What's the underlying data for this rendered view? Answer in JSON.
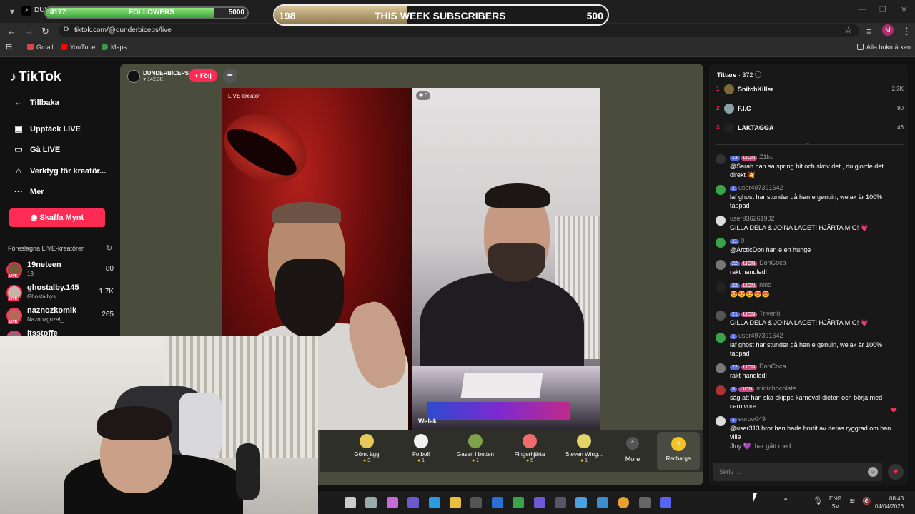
{
  "browser": {
    "tab_title": "DUNDERBICEPS",
    "url": "tiktok.com/@dunderbiceps/live",
    "profile_initial": "M",
    "bookmarks": [
      "Gmail",
      "YouTube",
      "Maps"
    ],
    "all_bookmarks": "Alla bokmärken"
  },
  "overlays": {
    "followers": {
      "current": "4177",
      "label": "FOLLOWERS",
      "goal": "5000",
      "progress": 0.835
    },
    "subscribers": {
      "current": "198",
      "label": "THIS WEEK SUBSCRIBERS",
      "goal": "500",
      "progress": 0.396
    }
  },
  "sidebar": {
    "logo": "TikTok",
    "back": "Tillbaka",
    "items": [
      {
        "label": "Upptäck LIVE",
        "icon": "calendar-live-icon"
      },
      {
        "label": "Gå LIVE",
        "icon": "camera-icon"
      },
      {
        "label": "Verktyg för kreatör...",
        "icon": "creator-tools-icon"
      },
      {
        "label": "Mer",
        "icon": "more-dots-icon"
      }
    ],
    "coins_button": "Skaffa Mynt",
    "suggested_title": "Föreslagna LIVE-kreatörer",
    "creators": [
      {
        "name": "19neteen",
        "sub": "19",
        "count": "80"
      },
      {
        "name": "ghostalby.145",
        "sub": "Ghostalbys",
        "count": "1.7K"
      },
      {
        "name": "naznozkomik",
        "sub": "Naznozguzel_",
        "count": "265"
      },
      {
        "name": "itsstoffe",
        "sub": "",
        "count": ""
      }
    ]
  },
  "live": {
    "host_name": "DUNDERBICEPS",
    "host_likes": "♥ 142.3K",
    "follow_label": "+ Följ",
    "left_label": "LIVE-kreatör",
    "right_badge": "0",
    "guest_name": "Welak",
    "gifts": [
      {
        "name": "Gömt ägg",
        "cost": "3",
        "color": "#e7c95b"
      },
      {
        "name": "Fotboll",
        "cost": "1",
        "color": "#f2f2f2"
      },
      {
        "name": "Gasen i botten",
        "cost": "1",
        "color": "#7ca34a"
      },
      {
        "name": "Fingerhjärta",
        "cost": "5",
        "color": "#f06b6b"
      },
      {
        "name": "Steven Wing...",
        "cost": "1",
        "color": "#e3d46a"
      }
    ],
    "more_label": "More",
    "recharge_label": "Recharge"
  },
  "chat": {
    "viewers_title": "Tittare",
    "viewers_count": "· 372",
    "top_viewers": [
      {
        "rank": "1",
        "name": "SnitchKiller",
        "score": "2.3K",
        "color": "#7a6a3a"
      },
      {
        "rank": "2",
        "name": "F.I.C",
        "score": "90",
        "color": "#8aa0a8"
      },
      {
        "rank": "3",
        "name": "LAKTAGGA",
        "score": "46",
        "color": "#222"
      }
    ],
    "messages": [
      {
        "level": "13",
        "fan": "LION",
        "user": "Z1ko",
        "text": "@Sarah han sa spring hit och skriv det , du gjorde det direkt 💥",
        "color": "#333"
      },
      {
        "level": "1",
        "fan": "",
        "user": "user497391642",
        "text": "laf ghost har stunder då han e genuin, welak är 100% tappad",
        "color": "#3aa34a"
      },
      {
        "level": "",
        "fan": "",
        "user": "user936261902",
        "text": "GILLA DELA & JOINA LAGET! HJÄRTA MIG! 💗",
        "color": "#ddd"
      },
      {
        "level": "11",
        "fan": "",
        "user": "0",
        "text": "@ArcticDon han e en hunge",
        "color": "#3aa34a"
      },
      {
        "level": "22",
        "fan": "LION",
        "user": "DonCoca",
        "text": "rakt handled!",
        "color": "#777"
      },
      {
        "level": "22",
        "fan": "LION",
        "user": "nino",
        "text": "😍😍😍😍😍",
        "color": "#222"
      },
      {
        "level": "21",
        "fan": "LION",
        "user": "Triventi",
        "text": "GILLA DELA & JOINA LAGET! HJÄRTA MIG! 💗",
        "color": "#555"
      },
      {
        "level": "1",
        "fan": "",
        "user": "user497391642",
        "text": "laf ghost har stunder då han e genuin, welak är 100% tappad",
        "color": "#3aa34a"
      },
      {
        "level": "22",
        "fan": "LION",
        "user": "DonCoca",
        "text": "rakt handled!",
        "color": "#777"
      },
      {
        "level": "3",
        "fan": "LION",
        "user": "mintchocolate",
        "text": "säg att han ska skippa karneval-dieten och börja med carnivore",
        "color": "#a33"
      },
      {
        "level": "1",
        "fan": "",
        "user": "euroo049",
        "text": "@user313 bror han hade brutit av deras ryggrad om han ville",
        "color": "#ddd"
      }
    ],
    "joined_user": "Jloy",
    "joined_text": "har gått med",
    "input_placeholder": "Skriv ..."
  },
  "taskbar": {
    "lang": "ENG",
    "region": "SV",
    "time": "08:43",
    "date": "04/04/2026"
  }
}
